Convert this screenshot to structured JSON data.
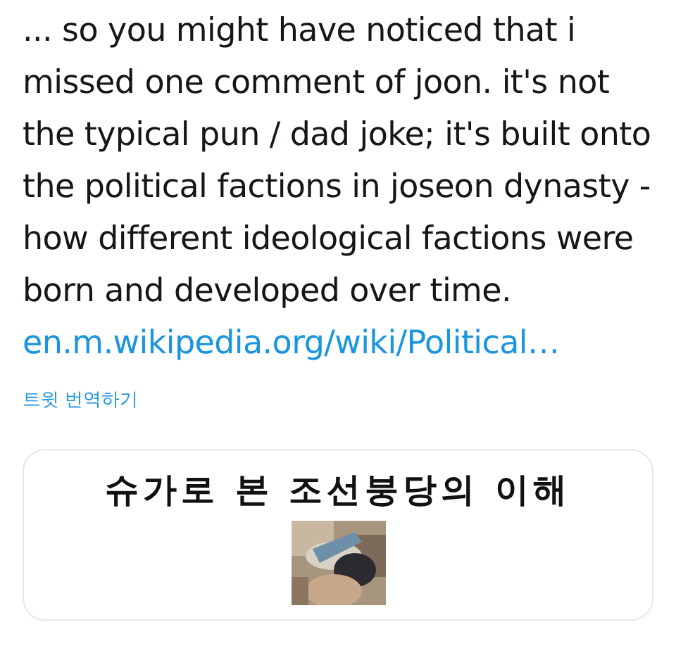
{
  "tweet": {
    "text": "... so you might have noticed that i missed one comment of joon. it's not the typical pun / dad joke; it's built onto the political factions in joseon dynasty - how different ideological factions were born and developed over time.",
    "link": "en.m.wikipedia.org/wiki/Political…",
    "translate": "트윗 번역하기"
  },
  "card": {
    "title": "슈가로 본 조선붕당의 이해"
  }
}
